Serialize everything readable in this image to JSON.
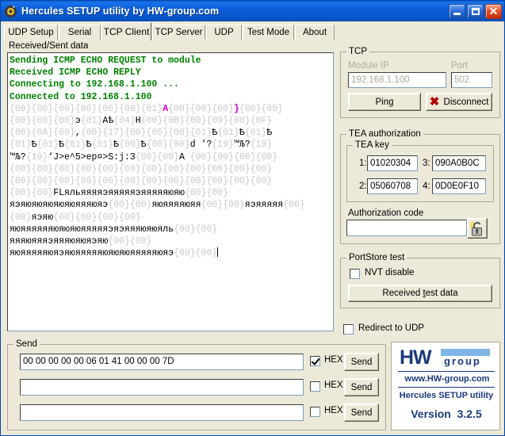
{
  "window": {
    "title": "Hercules SETUP utility by HW-group.com",
    "icon": "hercules-app-icon",
    "minimize_label": "_",
    "maximize_label": "□",
    "close_label": "✕"
  },
  "tabs": [
    {
      "label": "UDP Setup",
      "active": false
    },
    {
      "label": "Serial",
      "active": false
    },
    {
      "label": "TCP Client",
      "active": true
    },
    {
      "label": "TCP Server",
      "active": false
    },
    {
      "label": "UDP",
      "active": false
    },
    {
      "label": "Test Mode",
      "active": false
    },
    {
      "label": "About",
      "active": false
    }
  ],
  "console": {
    "label": "Received/Sent data",
    "lines": [
      {
        "style": "green",
        "text": "Sending ICMP ECHO REQUEST to module"
      },
      {
        "style": "green",
        "text": "Received ICMP ECHO REPLY"
      },
      {
        "style": "green",
        "text": "Connecting to 192.168.1.100 ..."
      },
      {
        "style": "green",
        "text": "Connected to 192.168.1.100"
      },
      {
        "style": "data",
        "segments": [
          {
            "t": "hex",
            "v": "{00}{00}{00}{00}{00}{06}{01}"
          },
          {
            "t": "pink",
            "v": "A"
          },
          {
            "t": "hex",
            "v": "{00}{00}{00}"
          },
          {
            "t": "pink",
            "v": "}"
          },
          {
            "t": "hex",
            "v": "{00}{00}"
          }
        ]
      },
      {
        "style": "data",
        "segments": [
          {
            "t": "hex",
            "v": "{00}{00}{00}"
          },
          {
            "t": "black",
            "v": "э"
          },
          {
            "t": "hex",
            "v": "{01}"
          },
          {
            "t": "black",
            "v": "Aѣ"
          },
          {
            "t": "hex",
            "v": "{04}"
          },
          {
            "t": "black",
            "v": "H"
          },
          {
            "t": "hex",
            "v": "{00}{0B}{00}{09}{00}{0F}"
          }
        ]
      },
      {
        "style": "data",
        "segments": [
          {
            "t": "hex",
            "v": "{00}{0A}{00}"
          },
          {
            "t": "black",
            "v": ","
          },
          {
            "t": "hex",
            "v": "{00}{17}{00}{05}{00}{01}"
          },
          {
            "t": "black",
            "v": "Ѣ"
          },
          {
            "t": "hex",
            "v": "{01}"
          },
          {
            "t": "black",
            "v": "Ѣ"
          },
          {
            "t": "hex",
            "v": "{01}"
          },
          {
            "t": "black",
            "v": "Ѣ"
          }
        ]
      },
      {
        "style": "data",
        "segments": [
          {
            "t": "hex",
            "v": "{01}"
          },
          {
            "t": "black",
            "v": "Ѣ"
          },
          {
            "t": "hex",
            "v": "{01}"
          },
          {
            "t": "black",
            "v": "Ѣ"
          },
          {
            "t": "hex",
            "v": "{01}"
          },
          {
            "t": "black",
            "v": "Ѣ"
          },
          {
            "t": "hex",
            "v": "{01}"
          },
          {
            "t": "black",
            "v": "Ѣ"
          },
          {
            "t": "hex",
            "v": "{00}"
          },
          {
            "t": "black",
            "v": "Ѣ"
          },
          {
            "t": "hex",
            "v": "{00}{00}"
          },
          {
            "t": "black",
            "v": "d '?"
          },
          {
            "t": "hex",
            "v": "{19}"
          },
          {
            "t": "black",
            "v": "™Љ?"
          },
          {
            "t": "hex",
            "v": "{19}"
          }
        ]
      },
      {
        "style": "data",
        "segments": [
          {
            "t": "black",
            "v": "™Љ?"
          },
          {
            "t": "hex",
            "v": "{19}"
          },
          {
            "t": "black",
            "v": "‘J>e^5>ep¤>S:j:3"
          },
          {
            "t": "hex",
            "v": "{00}{00}"
          },
          {
            "t": "black",
            "v": "A "
          },
          {
            "t": "hex",
            "v": "{00}{00}{00}{00}"
          }
        ]
      },
      {
        "style": "data",
        "segments": [
          {
            "t": "hex",
            "v": "{00}{00}{00}{00}{00}{00}{00}{00}{00}{06}{00}{00}"
          }
        ]
      },
      {
        "style": "data",
        "segments": [
          {
            "t": "hex",
            "v": "{00}{00}{00}{00}{00}{00}{00}{00}{00}{00}{00}{00}"
          }
        ]
      },
      {
        "style": "data",
        "segments": [
          {
            "t": "hex",
            "v": "{00}{00}"
          },
          {
            "t": "black",
            "v": "FLяльяяяяэяяяяяэяяяяяюяю"
          },
          {
            "t": "hex",
            "v": "{00}{00}"
          }
        ]
      },
      {
        "style": "data",
        "segments": [
          {
            "t": "black",
            "v": "яэяюяюяюяюяюяяяюяэ"
          },
          {
            "t": "hex",
            "v": "{00}{00}"
          },
          {
            "t": "black",
            "v": "яюяяяяюяя"
          },
          {
            "t": "hex",
            "v": "{00}{00}"
          },
          {
            "t": "black",
            "v": "яэяяяяя"
          },
          {
            "t": "hex",
            "v": "{00}"
          }
        ]
      },
      {
        "style": "data",
        "segments": [
          {
            "t": "hex",
            "v": "{00}"
          },
          {
            "t": "black",
            "v": "яэяю"
          },
          {
            "t": "hex",
            "v": "{00}{00}{00}{00}"
          }
        ]
      },
      {
        "style": "data",
        "segments": [
          {
            "t": "black",
            "v": "яюяяяяяяюяюяюяяяяяэяэяяяюяюяль"
          },
          {
            "t": "hex",
            "v": "{00}{00}"
          }
        ]
      },
      {
        "style": "data",
        "segments": [
          {
            "t": "black",
            "v": "яяяюяяяэяяяюяюяэяю"
          },
          {
            "t": "hex",
            "v": "{00}{00}"
          }
        ]
      },
      {
        "style": "data",
        "segments": [
          {
            "t": "black",
            "v": "яюяяяяяюяэяюяяяяяюяюяюяяяяяюяэ"
          },
          {
            "t": "hex",
            "v": "{00}{00}"
          },
          {
            "t": "caret",
            "v": ""
          }
        ]
      }
    ]
  },
  "tcp": {
    "group_label": "TCP",
    "module_ip_label": "Module IP",
    "module_ip_value": "192.168.1.100",
    "port_label": "Port",
    "port_value": "502",
    "ping_label": "Ping",
    "disconnect_label": "Disconnect",
    "disconnect_icon": "red-x-icon"
  },
  "tea": {
    "group_label": "TEA authorization",
    "key_group_label": "TEA key",
    "keys": [
      {
        "num": "1:",
        "value": "01020304"
      },
      {
        "num": "2:",
        "value": "05060708"
      },
      {
        "num": "3:",
        "value": "090A0B0C"
      },
      {
        "num": "4:",
        "value": "0D0E0F10"
      }
    ],
    "auth_code_label": "Authorization code",
    "auth_code_value": "",
    "lock_icon": "padlock-icon"
  },
  "portstore": {
    "group_label": "PortStore test",
    "nvt_disable_label": "NVT disable",
    "nvt_disable_checked": false,
    "received_test_data_label_pre": "Received ",
    "received_test_data_accel": "t",
    "received_test_data_label_post": "est data"
  },
  "redirect": {
    "label": "Redirect to UDP",
    "checked": false
  },
  "send": {
    "group_label": "Send",
    "hex_label": "HEX",
    "send_label": "Send",
    "rows": [
      {
        "value": "00 00 00 00 00 06 01 41 00 00 00 7D",
        "hex_checked": true
      },
      {
        "value": "",
        "hex_checked": false
      },
      {
        "value": "",
        "hex_checked": false
      }
    ]
  },
  "logo": {
    "hw": "HW",
    "group": "group",
    "url": "www.HW-group.com",
    "app": "Hercules SETUP utility",
    "version_label": "Version",
    "version_number": "3.2.5"
  },
  "colors": {
    "titlebar": "#0b5ed9",
    "face": "#ece9d8",
    "green_text": "#008000",
    "hex_grey": "#c8c8c8",
    "pink": "#cc00cc",
    "logo_blue": "#1b3a7a",
    "red": "#b00000"
  }
}
